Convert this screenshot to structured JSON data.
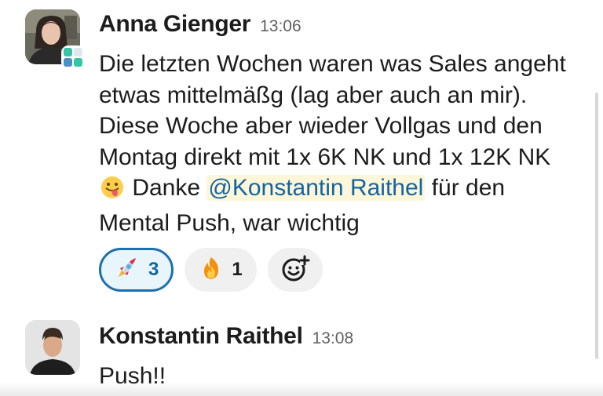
{
  "messages": [
    {
      "sender": "Anna Gienger",
      "time": "13:06",
      "text_before_emoji": "Die letzten Wochen waren was Sales angeht etwas mittelmäßg (lag aber auch an mir). Diese Woche aber wieder Vollgas und den Montag direkt mit 1x 6K NK und 1x 12K NK ",
      "emoji_inline": "tongue-out-face",
      "text_after_emoji": " Danke ",
      "mention": "@Konstantin Raithel",
      "text_after_mention": " für den Mental Push, war wichtig",
      "badge_icon": "org-logo-icon",
      "reactions": [
        {
          "icon": "rocket-icon",
          "count": "3",
          "active": true
        },
        {
          "icon": "fire-icon",
          "count": "1",
          "active": false
        }
      ],
      "add_reaction_icon": "add-reaction-icon"
    },
    {
      "sender": "Konstantin Raithel",
      "time": "13:08",
      "text": "Push!!"
    }
  ],
  "colors": {
    "mention_bg": "#fef6d8",
    "mention_text": "#1264a3",
    "active_reaction_border": "#1d6fae",
    "timestamp": "#616061"
  }
}
